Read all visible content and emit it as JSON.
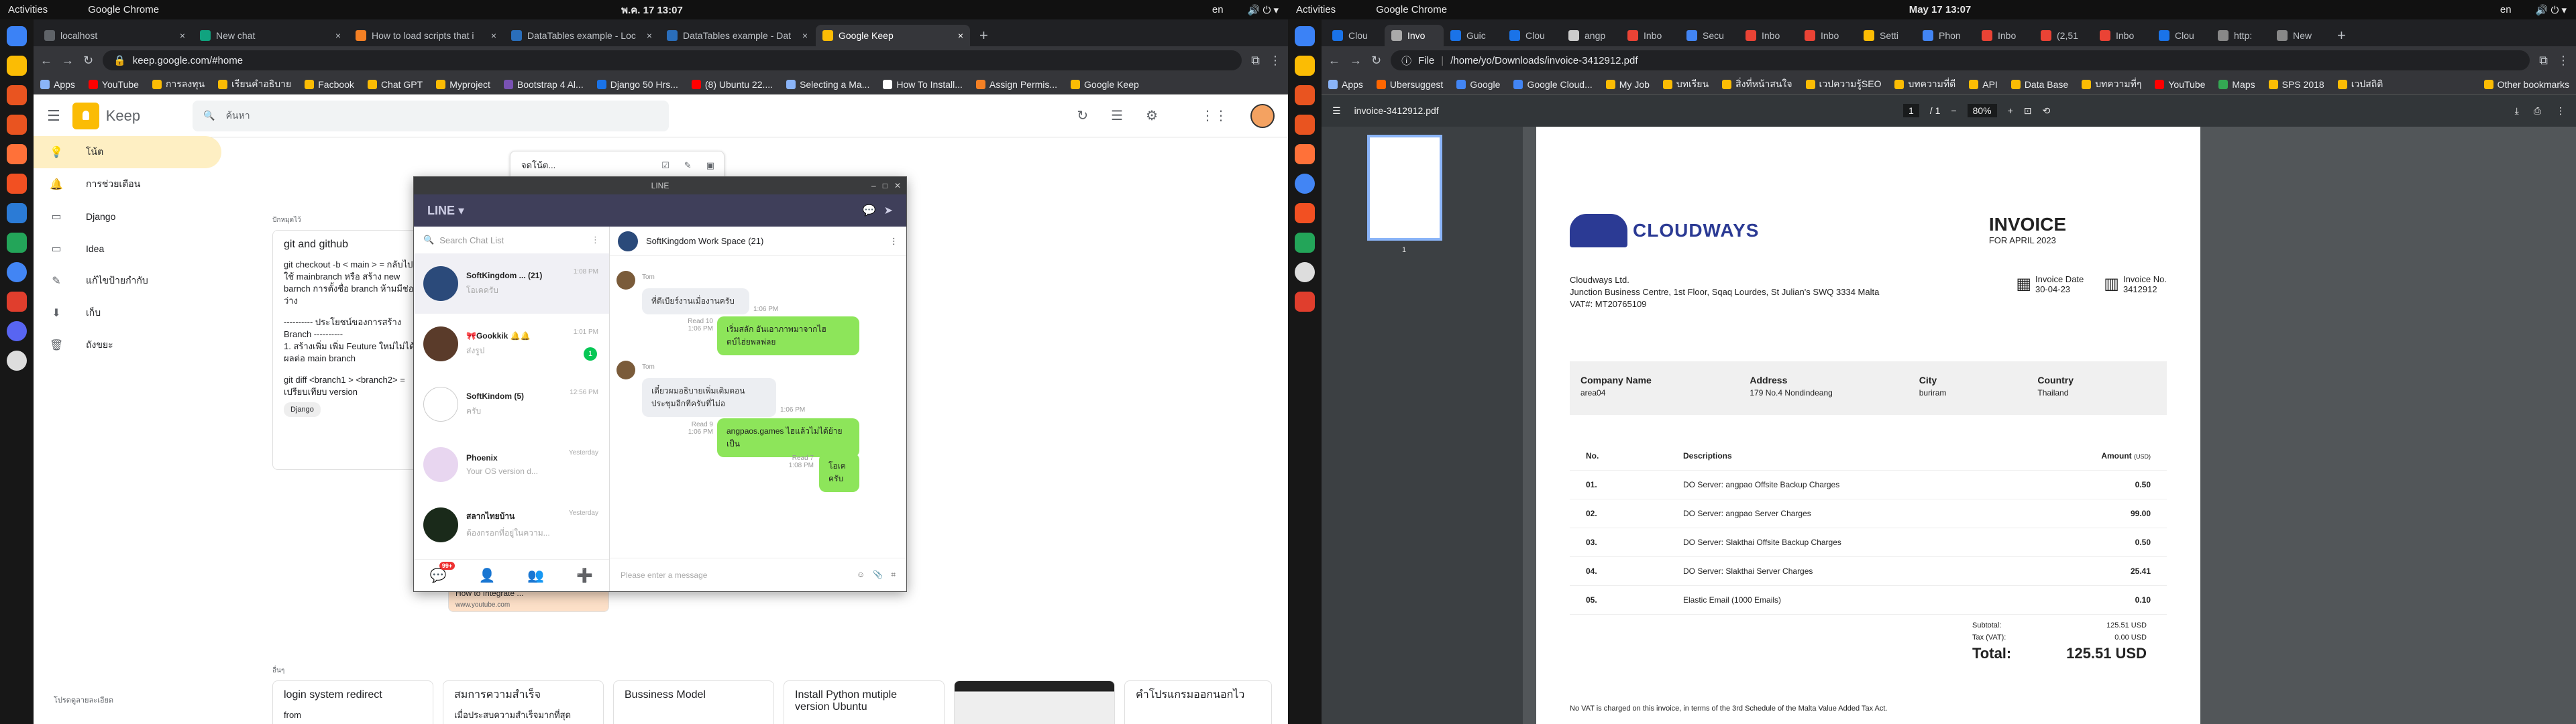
{
  "left_screen": {
    "topbar": {
      "activities": "Activities",
      "app": "Google Chrome",
      "clock": "พ.ค. 17  13:07",
      "lang": "en"
    },
    "tabs": [
      {
        "label": "localhost",
        "color": "#5f6368"
      },
      {
        "label": "New chat",
        "color": "#10a37f"
      },
      {
        "label": "How to load scripts that i",
        "color": "#f48024"
      },
      {
        "label": "DataTables example - Loc",
        "color": "#2a6ebb"
      },
      {
        "label": "DataTables example - Dat",
        "color": "#2a6ebb"
      },
      {
        "label": "Google Keep",
        "color": "#fbbc04"
      }
    ],
    "url": "keep.google.com/#home",
    "bookmarks": [
      "Apps",
      "YouTube",
      "การลงทุน",
      "เรียนคำอธิบาย",
      "Facbook",
      "Chat GPT",
      "Myproject",
      "Bootstrap 4 Al...",
      "Django 50 Hrs...",
      "(8) Ubuntu 22....",
      "Selecting a Ma...",
      "How To Install...",
      "Assign Permis...",
      "Google Keep"
    ],
    "keep": {
      "name": "Keep",
      "search_placeholder": "ค้นหา",
      "sidebar": [
        {
          "label": "โน้ต",
          "icon": "💡"
        },
        {
          "label": "การช่วยเตือน",
          "icon": "🔔"
        },
        {
          "label": "Django",
          "icon": "🏷"
        },
        {
          "label": "Idea",
          "icon": "🏷"
        },
        {
          "label": "แก้ไขป้ายกำกับ",
          "icon": "✎"
        },
        {
          "label": "เก็บ",
          "icon": "⬇"
        },
        {
          "label": "ถังขยะ",
          "icon": "🗑"
        }
      ],
      "take_note": "จดโน้ต...",
      "pinned_label": "ปักหมุดไว้",
      "other_label": "อื่นๆ",
      "note1": {
        "title": "git and github",
        "body": [
          "git checkout -b < main > = กลับไปใช้ mainbranch  หรือ สร้าง new barnch การตั้งชื่อ branch ห้ามมีช่องว่าง",
          "---------- ประโยชน์ของการสร้าง Branch ----------",
          "1. สร้างเพิ่ม เพิ่ม Feuture ใหม่ไม่ได้มีผลต่อ main branch",
          "git diff <branch1 > <branch2> = เปรียบเทียบ version"
        ],
        "label": "Django"
      },
      "yt_card": {
        "title": "How to Integrate ...",
        "url": "www.youtube.com"
      },
      "other_notes": [
        {
          "title": "login system redirect",
          "body": "from"
        },
        {
          "title": "สมการความสำเร็จ",
          "body": "เมื่อประสบความสำเร็จมากที่สุด"
        },
        {
          "title": "Bussiness Model",
          "body": ""
        },
        {
          "title": "Install Python mutiple version Ubuntu",
          "body": ""
        },
        {
          "title": "",
          "body": ""
        },
        {
          "title": "คำโปรแกรมออกนอกไว",
          "body": ""
        }
      ],
      "footer": "โปรดดูลายละเอียด"
    },
    "line": {
      "window_title": "LINE",
      "brand": "LINE ▾",
      "search_placeholder": "Search Chat List",
      "chats": [
        {
          "name": "SoftKingdom ...",
          "count": "(21)",
          "sub": "โอเคครับ",
          "time": "1:08 PM",
          "color": "#2b4a7a"
        },
        {
          "name": "🎀Gookkik 🔔🔔",
          "count": "",
          "sub": "ส่งรูป",
          "time": "1:01 PM",
          "color": "#5a3b2a",
          "badge": "1"
        },
        {
          "name": "SoftKindom",
          "count": "(5)",
          "sub": "ครับ",
          "time": "12:56 PM",
          "color": "#222"
        },
        {
          "name": "Phoenix",
          "count": "",
          "sub": "Your OS version d...",
          "time": "Yesterday",
          "color": "#e8d6f0"
        },
        {
          "name": "สลากไทยบ้าน",
          "count": "",
          "sub": "ต้องกรอกที่อยู่ในความ...",
          "time": "Yesterday",
          "color": "#1a2a1a"
        }
      ],
      "room": "SoftKingdom Work Space (21)",
      "messages": [
        {
          "from": "Tom",
          "text": "ที่ดีเบียร์งานเมื่องานครับ",
          "time": "1:06 PM",
          "dir": "in"
        },
        {
          "from": "",
          "text": "เริ่มสลัก อันเอาภาพมาจากไฮตบ์ไฮ่ยพลพ่ลย",
          "time": "1:06 PM",
          "read": "Read 10",
          "dir": "out"
        },
        {
          "from": "Tom",
          "text": "เดี๋ยวผมอธิบายเพิ่มเติมตอนประชุมอีกทีครับที่ไม่อ",
          "time": "1:06 PM",
          "dir": "in"
        },
        {
          "from": "",
          "text": "angpaos.games ไฮแล้วไม่ได้ย้ายเป็น",
          "time": "1:06 PM",
          "read": "Read 9",
          "dir": "out"
        },
        {
          "from": "",
          "text": "โอเคครับ",
          "time": "1:08 PM",
          "read": "Read 7",
          "dir": "out"
        }
      ],
      "input_placeholder": "Please enter a message",
      "notif_badge": "99+"
    }
  },
  "right_screen": {
    "topbar": {
      "activities": "Activities",
      "app": "Google Chrome",
      "clock": "May 17  13:07",
      "lang": "en"
    },
    "tabs": [
      "Clou",
      "Invo",
      "Guic",
      "Clou",
      "angp",
      "Inbo",
      "Secu",
      "Inbo",
      "Inbo",
      "Setti",
      "Phon",
      "Inbo",
      "(2,51",
      "Inbo",
      "Clou",
      "http:",
      "New"
    ],
    "url": "/home/yo/Downloads/invoice-3412912.pdf",
    "url_prefix": "File",
    "bookmarks": [
      "Apps",
      "Ubersuggest",
      "Google",
      "Google Cloud...",
      "My Job",
      "บทเรียน",
      "สิ่งที่หน้าสนใจ",
      "เวปความรู้SEO",
      "บทความที่ดี",
      "API",
      "Data Base",
      "บทความที่ๆ",
      "YouTube",
      "Maps",
      "SPS 2018",
      "เวปสถิติ",
      "Other bookmarks"
    ],
    "pdf": {
      "filename": "invoice-3412912.pdf",
      "page": "1",
      "pages": "/ 1",
      "zoom": "80%",
      "thumb_num": "1",
      "brand": "CLOUDWAYS",
      "heading": "INVOICE",
      "subheading": "FOR APRIL 2023",
      "company": "Cloudways Ltd.",
      "address": "Junction Business Centre, 1st Floor, Sqaq Lourdes, St Julian's SWQ 3334 Malta",
      "vat": "VAT#: MT20765109",
      "date_label": "Invoice Date",
      "date": "30-04-23",
      "no_label": "Invoice No.",
      "no": "3412912",
      "info": [
        {
          "label": "Company Name",
          "value": "area04"
        },
        {
          "label": "Address",
          "value": "179 No.4 Nondindeang"
        },
        {
          "label": "City",
          "value": "buriram"
        },
        {
          "label": "Country",
          "value": "Thailand"
        }
      ],
      "col_no": "No.",
      "col_desc": "Descriptions",
      "col_amt": "Amount",
      "col_amt_unit": "(USD)",
      "items": [
        {
          "no": "01.",
          "desc": "DO Server: angpao Offsite Backup Charges",
          "amt": "0.50"
        },
        {
          "no": "02.",
          "desc": "DO Server: angpao Server Charges",
          "amt": "99.00"
        },
        {
          "no": "03.",
          "desc": "DO Server: Slakthai Offsite Backup Charges",
          "amt": "0.50"
        },
        {
          "no": "04.",
          "desc": "DO Server: Slakthai Server Charges",
          "amt": "25.41"
        },
        {
          "no": "05.",
          "desc": "Elastic Email (1000 Emails)",
          "amt": "0.10"
        }
      ],
      "subtotal_label": "Subtotal:",
      "subtotal": "125.51 USD",
      "tax_label": "Tax (VAT):",
      "tax": "0.00 USD",
      "total_label": "Total:",
      "total": "125.51 USD",
      "note": "No VAT is charged on this invoice, in terms of the 3rd Schedule of the Malta Value Added Tax Act."
    }
  }
}
